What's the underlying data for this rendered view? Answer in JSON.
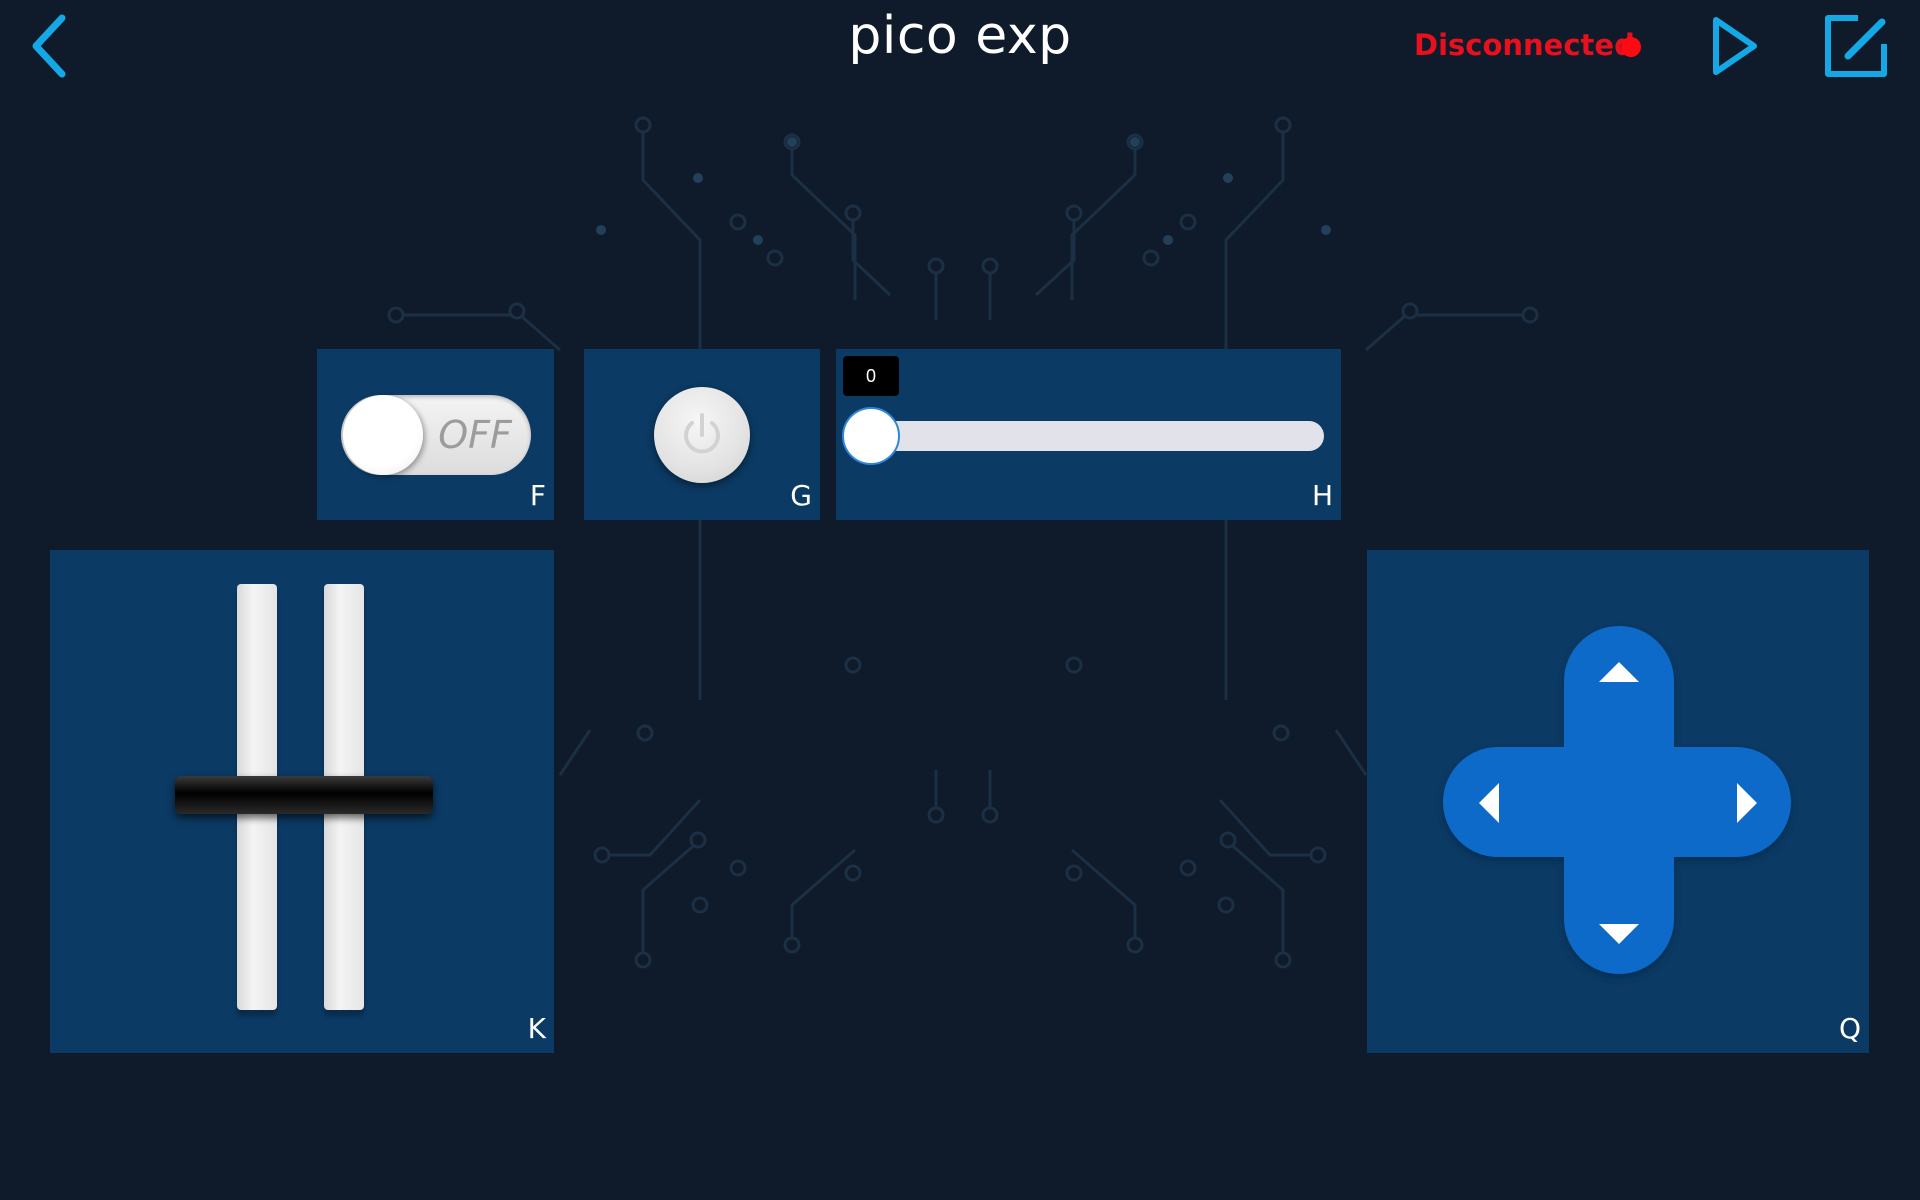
{
  "header": {
    "title": "pico exp",
    "status_text": "Disconnected",
    "status_color": "#e8101c",
    "back_icon": "chevron-left-icon",
    "play_icon": "play-icon",
    "edit_icon": "edit-icon"
  },
  "widgets": {
    "switch": {
      "label": "F",
      "state": "OFF"
    },
    "button": {
      "label": "G",
      "icon": "power-icon"
    },
    "slider": {
      "label": "H",
      "value": "0"
    },
    "throttle": {
      "label": "K"
    },
    "dpad": {
      "label": "Q",
      "icons": [
        "arrow-up-icon",
        "arrow-left-icon",
        "arrow-right-icon",
        "arrow-down-icon"
      ]
    }
  },
  "colors": {
    "background": "#0f1a2b",
    "panel": "#0b3a64",
    "accent": "#14a9e6",
    "dpad": "#0a6ac8"
  }
}
